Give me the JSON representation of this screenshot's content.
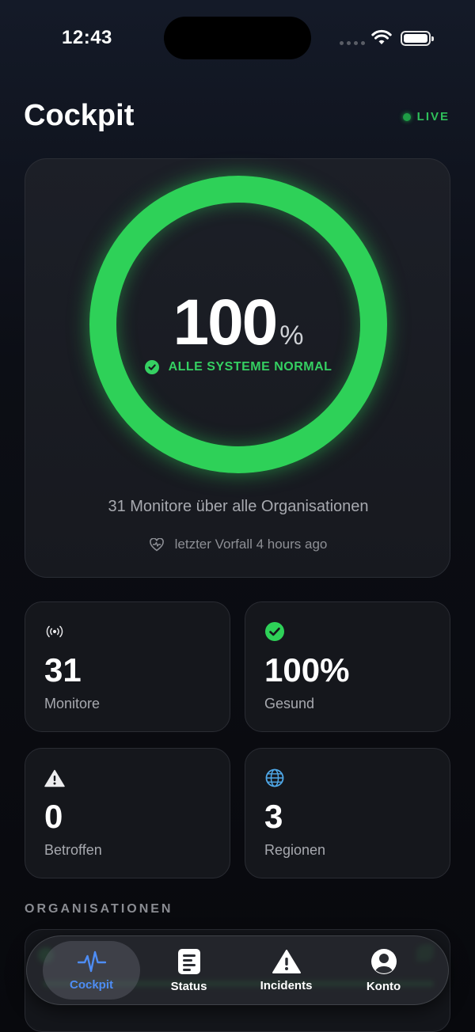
{
  "status_bar": {
    "time": "12:43"
  },
  "header": {
    "title": "Cockpit",
    "live_label": "LIVE"
  },
  "hero": {
    "percent_value": "100",
    "percent_unit": "%",
    "uptime_fraction": 1.0,
    "status_text": "ALLE SYSTEME NORMAL",
    "subtitle": "31 Monitore über alle Organisationen",
    "last_incident": "letzter Vorfall 4 hours ago"
  },
  "stats": [
    {
      "icon": "antenna-icon",
      "value": "31",
      "label": "Monitore"
    },
    {
      "icon": "check-circle-icon",
      "value": "100%",
      "label": "Gesund"
    },
    {
      "icon": "warning-triangle-icon",
      "value": "0",
      "label": "Betroffen"
    },
    {
      "icon": "globe-icon",
      "value": "3",
      "label": "Regionen"
    }
  ],
  "organisations": {
    "section_title": "ORGANISATIONEN"
  },
  "tabs": [
    {
      "label": "Cockpit",
      "icon": "pulse-icon",
      "active": true
    },
    {
      "label": "Status",
      "icon": "document-list-icon",
      "active": false
    },
    {
      "label": "Incidents",
      "icon": "warning-triangle-icon",
      "active": false
    },
    {
      "label": "Konto",
      "icon": "person-circle-icon",
      "active": false
    }
  ],
  "colors": {
    "accent_green": "#2ed158",
    "active_tab_blue": "#4e8df5",
    "background": "#0c0e15"
  }
}
